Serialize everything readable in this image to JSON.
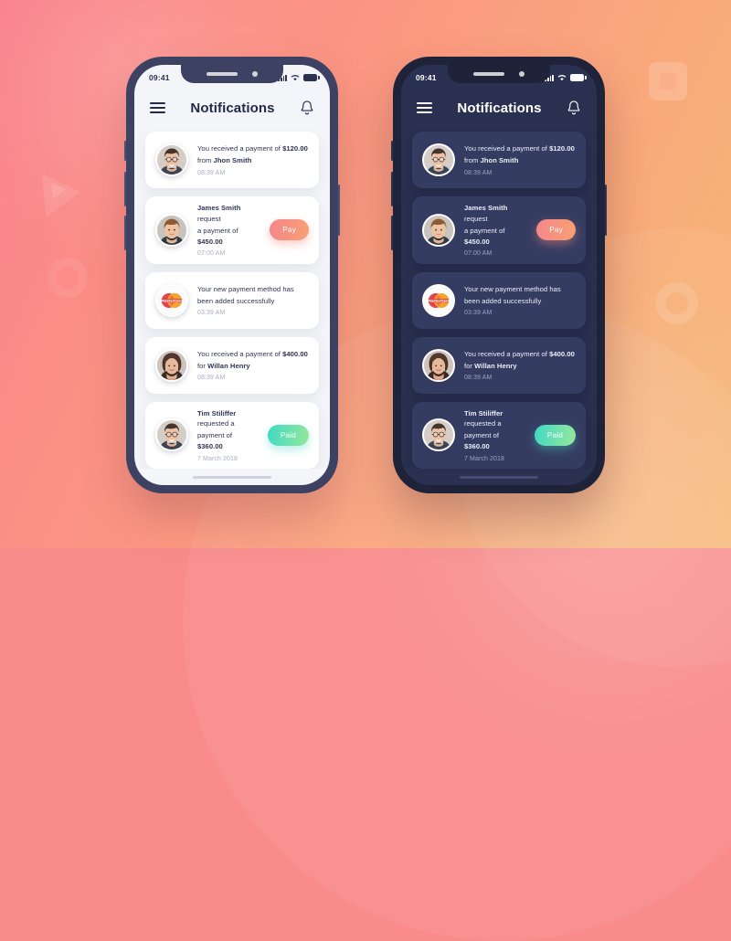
{
  "background": {
    "gradient_from": "#f9828f",
    "gradient_to": "#f6b775",
    "shapes": [
      "triangle",
      "rounded-square",
      "ring",
      "circle-glow"
    ]
  },
  "phones": [
    {
      "theme": "light",
      "frame_color": "#3e4262",
      "screen_bg": "#f4f5f8",
      "card_bg": "#ffffff",
      "text_color": "#2e3455",
      "status": {
        "time": "09:41",
        "signal_icon": "signal-bars-icon",
        "wifi_icon": "wifi-icon",
        "battery_icon": "battery-icon"
      },
      "header": {
        "menu_icon": "hamburger-menu-icon",
        "title": "Notifications",
        "bell_icon": "bell-icon"
      },
      "notifications": [
        {
          "avatar": "avatar-man-glasses",
          "line1_prefix": "You received a payment of ",
          "line1_bold": "$120.00",
          "line2_prefix": "from ",
          "line2_bold": "Jhon Smith",
          "time": "08:39 AM",
          "action": null
        },
        {
          "avatar": "avatar-young-man",
          "line1_bold": "James Smith",
          "line1_suffix": " request",
          "line2_prefix": "a payment of ",
          "line2_bold": "$450.00",
          "time": "07:00 AM",
          "action": {
            "label": "Pay",
            "style": "pay",
            "color": "#f4868b"
          }
        },
        {
          "avatar": "mastercard-icon",
          "line1_prefix": "Your new payment method has",
          "line2_prefix": "been added successfully",
          "time": "03:39 AM",
          "action": null
        },
        {
          "avatar": "avatar-woman",
          "line1_prefix": "You received a payment of ",
          "line1_bold": "$400.00",
          "line2_prefix": "for ",
          "line2_bold": "Willan Henry",
          "time": "08:39 AM",
          "action": null
        },
        {
          "avatar": "avatar-man-glasses",
          "line1_bold": "Tim Stiliffer",
          "line1_suffix": " requested a",
          "line2_prefix": "payment of ",
          "line2_bold": "$360.00",
          "time": "7 March 2018",
          "action": {
            "label": "Paid",
            "style": "paid",
            "color": "#3fd9c4"
          }
        }
      ]
    },
    {
      "theme": "dark",
      "frame_color": "#1e2339",
      "screen_bg": "#2a3050",
      "card_bg": "#353c62",
      "text_color": "#eceef7",
      "status": {
        "time": "09:41",
        "signal_icon": "signal-bars-icon",
        "wifi_icon": "wifi-icon",
        "battery_icon": "battery-icon"
      },
      "header": {
        "menu_icon": "hamburger-menu-icon",
        "title": "Notifications",
        "bell_icon": "bell-icon"
      },
      "notifications": [
        {
          "avatar": "avatar-man-glasses",
          "line1_prefix": "You received a payment of ",
          "line1_bold": "$120.00",
          "line2_prefix": "from ",
          "line2_bold": "Jhon Smith",
          "time": "08:39 AM",
          "action": null
        },
        {
          "avatar": "avatar-young-man",
          "line1_bold": "James Smith",
          "line1_suffix": " request",
          "line2_prefix": "a payment of ",
          "line2_bold": "$450.00",
          "time": "07:00 AM",
          "action": {
            "label": "Pay",
            "style": "pay",
            "color": "#f4868b"
          }
        },
        {
          "avatar": "mastercard-icon",
          "line1_prefix": "Your new payment method has",
          "line2_prefix": "been added successfully",
          "time": "03:39 AM",
          "action": null
        },
        {
          "avatar": "avatar-woman",
          "line1_prefix": "You received a payment of ",
          "line1_bold": "$400.00",
          "line2_prefix": "for ",
          "line2_bold": "Willan Henry",
          "time": "08:39 AM",
          "action": null
        },
        {
          "avatar": "avatar-man-glasses",
          "line1_bold": "Tim Stiliffer",
          "line1_suffix": " requested a",
          "line2_prefix": "payment of ",
          "line2_bold": "$360.00",
          "time": "7 March 2018",
          "action": {
            "label": "Paid",
            "style": "paid",
            "color": "#3fd9c4"
          }
        }
      ]
    }
  ]
}
